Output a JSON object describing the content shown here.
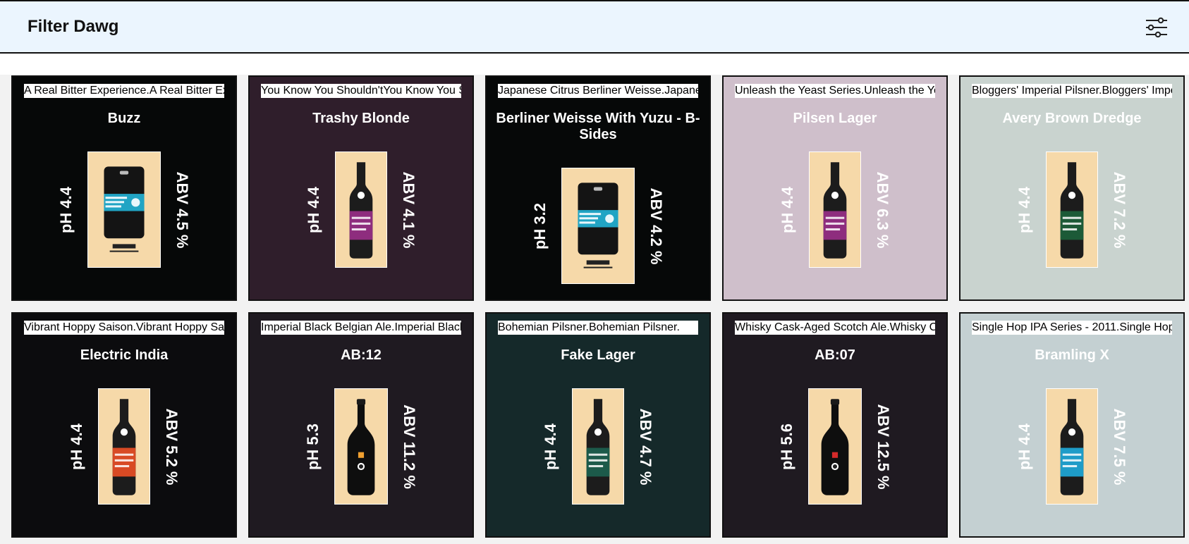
{
  "app": {
    "title": "Filter Dawg",
    "filter_icon": "sliders-icon"
  },
  "beers": [
    {
      "tagline": "A Real Bitter Experience.",
      "name": "Buzz",
      "ph": "pH 4.4",
      "abv": "ABV 4.5 %",
      "bg": "#060808",
      "fg": "#ffffff",
      "bottle": "keg",
      "label": "#21a4c4"
    },
    {
      "tagline": "You Know You Shouldn't",
      "name": "Trashy Blonde",
      "ph": "pH 4.4",
      "abv": "ABV 4.1 %",
      "bg": "#2f1e2b",
      "fg": "#ffffff",
      "bottle": "bottle",
      "label": "#8e2d7e"
    },
    {
      "tagline": "Japanese Citrus Berliner Weisse.",
      "name": "Berliner Weisse With Yuzu - B-Sides",
      "ph": "pH 3.2",
      "abv": "ABV 4.2 %",
      "bg": "#060808",
      "fg": "#ffffff",
      "bottle": "keg",
      "label": "#21a4c4"
    },
    {
      "tagline": "Unleash the Yeast Series.",
      "name": "Pilsen Lager",
      "ph": "pH 4.4",
      "abv": "ABV 6.3 %",
      "bg": "#cfbfcb",
      "fg": "#ffffff",
      "bottle": "bottle",
      "label": "#8e2d7e"
    },
    {
      "tagline": "Bloggers' Imperial Pilsner.",
      "name": "Avery Brown Dredge",
      "ph": "pH 4.4",
      "abv": "ABV 7.2 %",
      "bg": "#c9d3cf",
      "fg": "#ffffff",
      "bottle": "bottle",
      "label": "#1c5a37"
    },
    {
      "tagline": "Vibrant Hoppy Saison.",
      "name": "Electric India",
      "ph": "pH 4.4",
      "abv": "ABV 5.2 %",
      "bg": "#0c0c0e",
      "fg": "#ffffff",
      "bottle": "bottle",
      "label": "#d84a24"
    },
    {
      "tagline": "Imperial Black Belgian Ale.",
      "name": "AB:12",
      "ph": "pH 5.3",
      "abv": "ABV 11.2 %",
      "bg": "#1f1a21",
      "fg": "#ffffff",
      "bottle": "big",
      "label": "#f0a030"
    },
    {
      "tagline": "Bohemian Pilsner.",
      "name": "Fake Lager",
      "ph": "pH 4.4",
      "abv": "ABV 4.7 %",
      "bg": "#15292a",
      "fg": "#ffffff",
      "bottle": "bottle",
      "label": "#1c5a4a"
    },
    {
      "tagline": "Whisky Cask-Aged Scotch Ale.",
      "name": "AB:07",
      "ph": "pH 5.6",
      "abv": "ABV 12.5 %",
      "bg": "#1f1a21",
      "fg": "#ffffff",
      "bottle": "big",
      "label": "#d42a2a"
    },
    {
      "tagline": "Single Hop IPA Series - 2011.",
      "name": "Bramling X",
      "ph": "pH 4.4",
      "abv": "ABV 7.5 %",
      "bg": "#c4d0d2",
      "fg": "#ffffff",
      "bottle": "bottle",
      "label": "#1e9cc8"
    }
  ]
}
